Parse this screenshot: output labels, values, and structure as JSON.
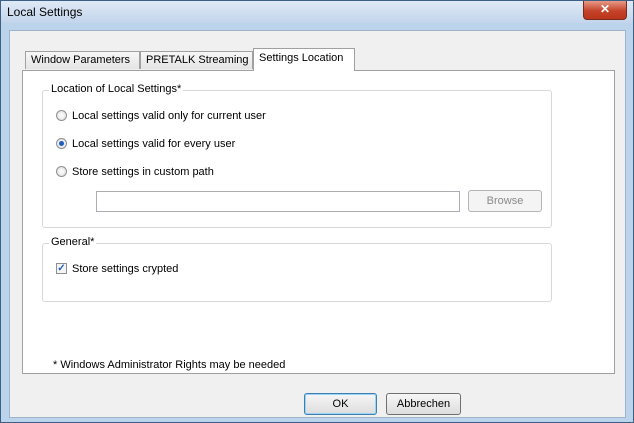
{
  "window": {
    "title": "Local Settings",
    "close_glyph": "✕"
  },
  "tabs": [
    {
      "label": "Window Parameters",
      "active": false
    },
    {
      "label": "PRETALK Streaming",
      "active": false
    },
    {
      "label": "Settings Location",
      "active": true
    }
  ],
  "location_group": {
    "legend": "Location of Local Settings*",
    "options": [
      {
        "label": "Local settings valid only for current user",
        "selected": false
      },
      {
        "label": "Local settings valid for every user",
        "selected": true
      },
      {
        "label": "Store settings in custom path",
        "selected": false
      }
    ],
    "path_value": "",
    "browse_label": "Browse"
  },
  "general_group": {
    "legend": "General*",
    "crypt_label": "Store settings crypted",
    "crypt_checked": true,
    "check_glyph": "✓"
  },
  "footnote": "* Windows Administrator Rights may be needed",
  "buttons": {
    "ok_label": "OK",
    "cancel_label": "Abbrechen"
  }
}
